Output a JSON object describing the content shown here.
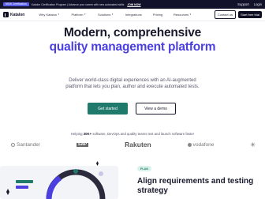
{
  "announcement": {
    "badge": "NEW Certification",
    "message": "Katalon Certification Program | Advance your career with new automated skills",
    "cta": "JOIN NOW",
    "support": "Support",
    "login": "Login"
  },
  "nav": {
    "logo_text": "Katalon",
    "menu": [
      "Why Katalon",
      "Platform",
      "Solutions",
      "Integrations",
      "Pricing",
      "Resources"
    ],
    "contact_label": "Contact us",
    "trial_label": "Start free trial"
  },
  "hero": {
    "title_line1": "Modern, comprehensive",
    "title_line2": "quality management platform",
    "subtitle": "Deliver world-class digital experiences with an AI-augmented platform that lets you plan, author and execute automated tests.",
    "primary_cta": "Get started",
    "secondary_cta": "View a demo"
  },
  "social_proof": {
    "prefix": "Helping",
    "count": "30K+",
    "suffix": "software, DevOps and quality teams test and launch software faster"
  },
  "logos": {
    "santander": "Santander",
    "sap": "SAP",
    "rakuten": "Rakuten",
    "vodafone": "vodafone",
    "asterisk": "✳"
  },
  "feature": {
    "pill": "PLAN",
    "title": "Align requirements and testing strategy"
  },
  "colors": {
    "accent": "#4b3fe0",
    "cta_green": "#1f7a6c",
    "dark": "#0f0f23"
  }
}
